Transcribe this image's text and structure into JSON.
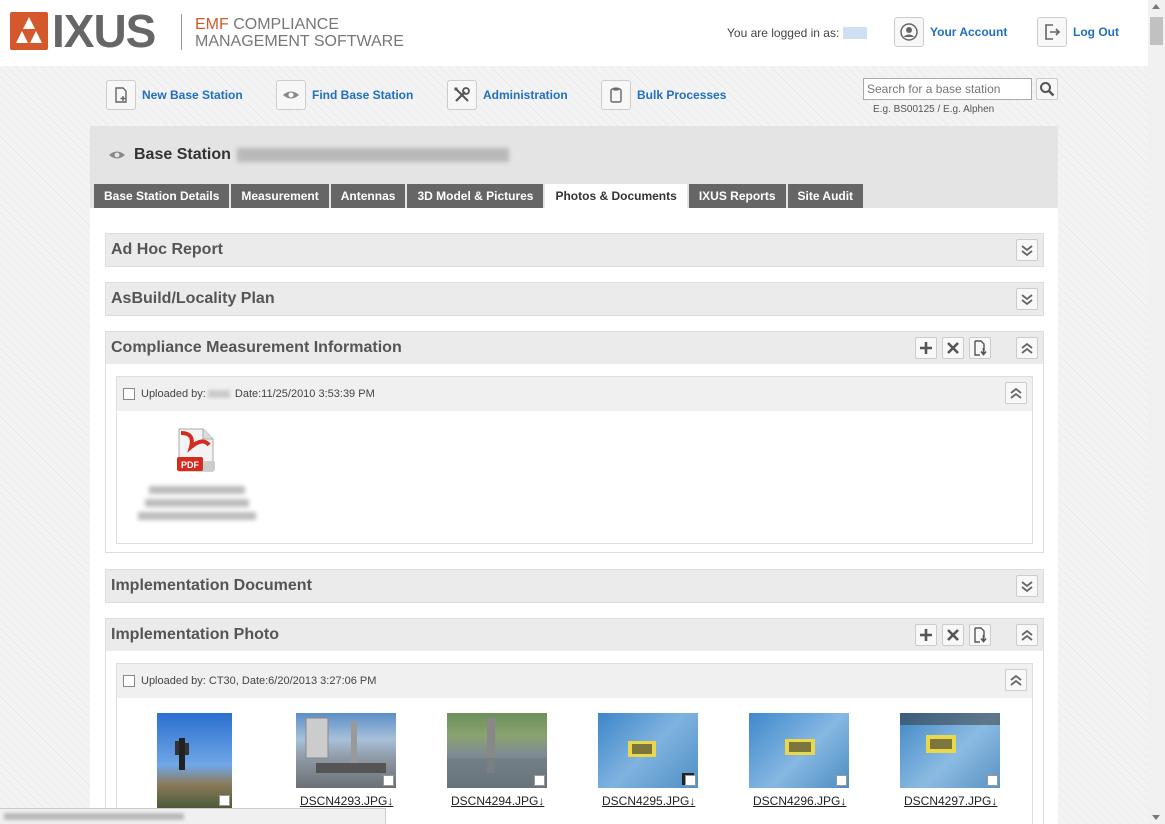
{
  "header": {
    "logo_text": "IXUS",
    "tagline_accent": "EMF",
    "tagline_line1_rest": " Compliance",
    "tagline_line2": "Management Software",
    "logged_in_label": "You are logged in as:",
    "your_account": "Your Account",
    "log_out": "Log Out"
  },
  "toolbar": {
    "new_base_station": "New Base Station",
    "find_base_station": "Find Base Station",
    "administration": "Administration",
    "bulk_processes": "Bulk Processes",
    "search_placeholder": "Search for a base station",
    "search_hint": "E.g. BS00125 / E.g. Alphen"
  },
  "page": {
    "title": "Base Station"
  },
  "tabs": [
    {
      "label": "Base Station Details"
    },
    {
      "label": "Measurement"
    },
    {
      "label": "Antennas"
    },
    {
      "label": "3D Model & Pictures"
    },
    {
      "label": "Photos & Documents"
    },
    {
      "label": "IXUS Reports"
    },
    {
      "label": "Site Audit"
    }
  ],
  "active_tab": "Photos & Documents",
  "sections": {
    "ad_hoc": "Ad Hoc Report",
    "asbuild": "AsBuild/Locality Plan",
    "compliance": "Compliance Measurement Information",
    "impl_doc": "Implementation Document",
    "impl_photo": "Implementation Photo"
  },
  "compliance_upload": {
    "uploaded_prefix": "Uploaded by:",
    "date": "Date:11/25/2010 3:53:39 PM",
    "file_type_badge": "PDF"
  },
  "photo_upload": {
    "uploaded_text": "Uploaded by: CT30, Date:6/20/2013 3:27:06 PM"
  },
  "photos": [
    {
      "caption": ""
    },
    {
      "caption": "DSCN4293.JPG↓"
    },
    {
      "caption": "DSCN4294.JPG↓"
    },
    {
      "caption": "DSCN4295.JPG↓"
    },
    {
      "caption": "DSCN4296.JPG↓"
    },
    {
      "caption": "DSCN4297.JPG↓"
    }
  ],
  "colors": {
    "brand_orange": "#d4582c",
    "link_blue": "#1f6fc2",
    "tab_dark": "#666666"
  }
}
